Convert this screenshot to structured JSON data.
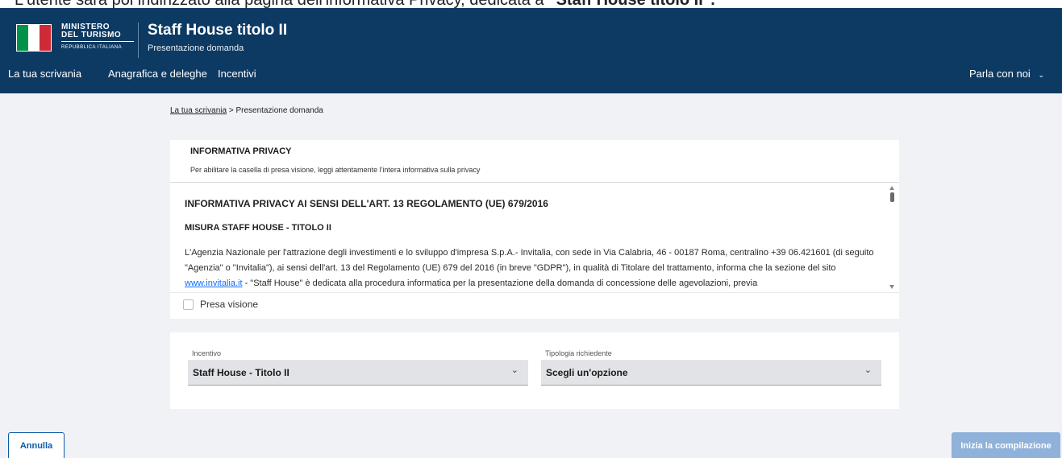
{
  "caption": {
    "text_prefix": "L'utente sarà poi indirizzato alla pagina dell'informativa Privacy, dedicata a ",
    "text_bold": "\"Staff House titolo II\"."
  },
  "header": {
    "ministry_line1": "MINISTERO",
    "ministry_line2": "DEL TURISMO",
    "ministry_line3": "REPUBBLICA ITALIANA",
    "app_title": "Staff House titolo II",
    "app_subtitle": "Presentazione domanda",
    "flag_colors": [
      "#009246",
      "#ffffff",
      "#ce2b37"
    ]
  },
  "nav": {
    "items": [
      "La tua scrivania",
      "Anagrafica e deleghe",
      "Incentivi"
    ],
    "right_label": "Parla con noi",
    "right_icon": "chevron-down-icon"
  },
  "breadcrumb": {
    "link": "La tua scrivania",
    "separator": ">",
    "current": "Presentazione domanda"
  },
  "privacy": {
    "heading": "INFORMATIVA PRIVACY",
    "instruction": "Per abilitare la casella di presa visione, leggi attentamente l'intera informativa sulla privacy",
    "doc_title": "INFORMATIVA PRIVACY AI SENSI DELL'ART. 13 REGOLAMENTO (UE) 679/2016",
    "doc_subtitle": "MISURA STAFF HOUSE - TITOLO II",
    "body_part1": "L'Agenzia Nazionale per l'attrazione degli investimenti e lo sviluppo d'impresa S.p.A.- Invitalia, con sede in Via Calabria, 46 - 00187 Roma, centralino +39 06.421601 (di seguito \"Agenzia\" o \"Invitalia\"), ai sensi dell'art. 13 del Regolamento (UE) 679 del 2016 (in breve \"GDPR\"), in qualità di Titolare del trattamento, informa che la sezione del sito ",
    "body_link": "www.invitalia.it",
    "body_part2": " - \"Staff House\" è dedicata alla procedura informatica per la presentazione della domanda di concessione delle agevolazioni, previa",
    "checkbox_label": "Presa visione"
  },
  "form": {
    "incentivo_label": "Incentivo",
    "incentivo_value": "Staff House - Titolo II",
    "tipologia_label": "Tipologia richiedente",
    "tipologia_value": "Scegli un'opzione"
  },
  "buttons": {
    "cancel": "Annulla",
    "start": "Inizia la compilazione"
  },
  "colors": {
    "header_bg": "#0d3a63",
    "content_bg": "#f0f2f6",
    "primary": "#0d5aa7",
    "primary_disabled": "#8fb1da"
  }
}
